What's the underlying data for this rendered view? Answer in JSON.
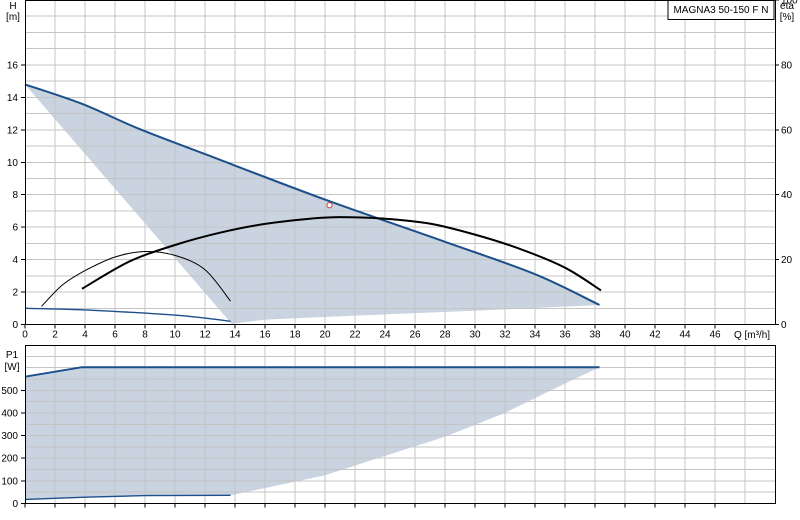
{
  "chart_data": [
    {
      "type": "line",
      "title": "MAGNA3 50-150 F N",
      "xlabel": "Q [m³/h]",
      "x_unit": "Q [m³/h]",
      "ylabel_left": [
        "H",
        "[m]"
      ],
      "ylabel_right": [
        "eta",
        "[%]"
      ],
      "xlim": [
        0,
        50
      ],
      "ylim_left": [
        0,
        20
      ],
      "ylim_right": [
        0,
        100
      ],
      "x_ticks": [
        0,
        2,
        4,
        6,
        8,
        10,
        12,
        14,
        16,
        18,
        20,
        22,
        24,
        26,
        28,
        30,
        32,
        34,
        36,
        38,
        40,
        42,
        44,
        46
      ],
      "y_ticks_left": [
        0,
        2,
        4,
        6,
        8,
        10,
        12,
        14,
        16
      ],
      "y_ticks_right": [
        0,
        20,
        40,
        60,
        80,
        100
      ],
      "grid": true,
      "series": [
        {
          "kind": "envelope",
          "upper": [
            [
              0,
              14.8
            ],
            [
              3.8,
              13.6
            ],
            [
              7.5,
              12.1
            ],
            [
              12,
              10.5
            ],
            [
              20,
              7.7
            ],
            [
              28,
              5.1
            ],
            [
              34,
              3.1
            ],
            [
              38.3,
              1.2
            ]
          ],
          "lower": [
            [
              38.3,
              1.2
            ],
            [
              30,
              0.85
            ],
            [
              22,
              0.55
            ],
            [
              16,
              0.3
            ],
            [
              13.8,
              0.05
            ],
            [
              13.8,
              0.02
            ]
          ]
        },
        {
          "kind": "head-max",
          "points": [
            [
              0,
              14.8
            ],
            [
              3.8,
              13.6
            ],
            [
              7.5,
              12.1
            ],
            [
              12,
              10.5
            ],
            [
              20,
              7.7
            ],
            [
              28,
              5.1
            ],
            [
              34,
              3.1
            ],
            [
              38.3,
              1.2
            ]
          ]
        },
        {
          "kind": "head-min",
          "points": [
            [
              0,
              1.0
            ],
            [
              4,
              0.9
            ],
            [
              8,
              0.7
            ],
            [
              11,
              0.5
            ],
            [
              13.7,
              0.2
            ]
          ]
        },
        {
          "kind": "eta-max",
          "points": [
            [
              3.8,
              11.0
            ],
            [
              7,
              19.5
            ],
            [
              10,
              24.5
            ],
            [
              13,
              28.3
            ],
            [
              16,
              31.0
            ],
            [
              19,
              32.6
            ],
            [
              21,
              33.1
            ],
            [
              24,
              32.6
            ],
            [
              27,
              31.1
            ],
            [
              30,
              27.7
            ],
            [
              33,
              23.3
            ],
            [
              36,
              17.5
            ],
            [
              38.4,
              10.5
            ]
          ]
        },
        {
          "kind": "eta-min",
          "points": [
            [
              1.1,
              5.6
            ],
            [
              2.5,
              12.2
            ],
            [
              4,
              16.6
            ],
            [
              6,
              20.8
            ],
            [
              8,
              22.5
            ],
            [
              10,
              21.3
            ],
            [
              12,
              16.9
            ],
            [
              13.7,
              7.2
            ]
          ]
        }
      ],
      "operating_point": {
        "x": 20.3,
        "y": 7.35
      }
    },
    {
      "type": "area",
      "xlabel": "",
      "ylabel": [
        "P1",
        "[W]"
      ],
      "xlim": [
        0,
        50
      ],
      "ylim": [
        0,
        700
      ],
      "x_ticks": [
        0,
        2,
        4,
        6,
        8,
        10,
        12,
        14,
        16,
        18,
        20,
        22,
        24,
        26,
        28,
        30,
        32,
        34,
        36,
        38,
        40,
        42,
        44,
        46
      ],
      "y_ticks": [
        0,
        100,
        200,
        300,
        400,
        500
      ],
      "grid": true,
      "series": [
        {
          "kind": "envelope",
          "upper": [
            [
              0,
              560
            ],
            [
              3.8,
              602
            ],
            [
              38.3,
              602
            ]
          ],
          "lower": [
            [
              38.3,
              602
            ],
            [
              36,
              530
            ],
            [
              32,
              400
            ],
            [
              28,
              295
            ],
            [
              24,
              210
            ],
            [
              20,
              125
            ],
            [
              16,
              68
            ],
            [
              13.7,
              36
            ],
            [
              8,
              35
            ],
            [
              4,
              28
            ],
            [
              0,
              18
            ]
          ]
        },
        {
          "kind": "power-max",
          "points": [
            [
              0,
              560
            ],
            [
              3.8,
              602
            ],
            [
              38.3,
              602
            ]
          ]
        },
        {
          "kind": "power-min",
          "points": [
            [
              0,
              18
            ],
            [
              4,
              28
            ],
            [
              8,
              35
            ],
            [
              13.7,
              36
            ]
          ]
        }
      ]
    }
  ]
}
